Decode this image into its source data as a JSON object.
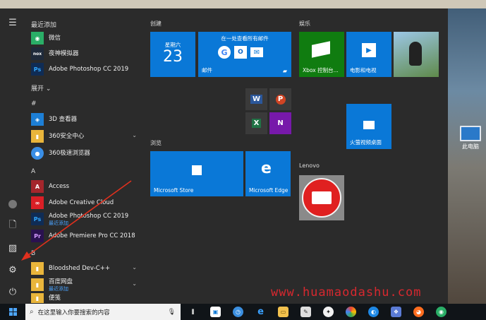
{
  "desktop": {
    "icon_label": "此电脑"
  },
  "sidebar": {
    "recent_header": "最近添加",
    "expand_label": "展开",
    "recent": [
      {
        "name": "微信",
        "color": "#2aae67",
        "glyph": "◉"
      },
      {
        "name": "夜神模拟器",
        "color": "#1f2a3a",
        "glyph": "nox"
      },
      {
        "name": "Adobe Photoshop CC 2019",
        "color": "#0f2c55",
        "glyph": "Ps"
      }
    ],
    "sections": [
      {
        "letter": "#",
        "items": [
          {
            "name": "3D 查看器",
            "color": "#1d7fd6",
            "glyph": "◈"
          },
          {
            "name": "360安全中心",
            "color": "#e9b53b",
            "glyph": "▮",
            "chevron": true
          },
          {
            "name": "360极速浏览器",
            "color": "#3a8ee6",
            "glyph": "●"
          }
        ]
      },
      {
        "letter": "A",
        "items": [
          {
            "name": "Access",
            "color": "#a4262c",
            "glyph": "A"
          },
          {
            "name": "Adobe Creative Cloud",
            "color": "#da1f26",
            "glyph": "∞"
          },
          {
            "name": "Adobe Photoshop CC 2019",
            "sub": "最近添加",
            "color": "#0f2c55",
            "glyph": "Ps"
          },
          {
            "name": "Adobe Premiere Pro CC 2018",
            "color": "#2a1150",
            "glyph": "Pr"
          }
        ]
      },
      {
        "letter": "B",
        "items": [
          {
            "name": "Bloodshed Dev-C++",
            "color": "#e9b53b",
            "glyph": "▮",
            "chevron": true
          },
          {
            "name": "百度网盘",
            "sub": "最近添加",
            "color": "#e9b53b",
            "glyph": "▮",
            "chevron": true
          },
          {
            "name": "便笺",
            "color": "#e9b53b",
            "glyph": "▮"
          }
        ]
      }
    ]
  },
  "groups": {
    "create": "创建",
    "entertainment": "娱乐",
    "browse": "浏览",
    "lenovo": "Lenovo"
  },
  "tiles": {
    "calendar_day": "星期六",
    "calendar_date": "23",
    "mail_header": "在一处查看所有邮件",
    "mail_label": "邮件",
    "xbox_label": "Xbox 控制台...",
    "movies_label": "电影和电视",
    "video_label": "火萤视频桌面",
    "store_label": "Microsoft Store",
    "edge_label": "Microsoft Edge",
    "word_glyph": "W",
    "ppt_glyph": "P",
    "excel_glyph": "X",
    "onenote_glyph": "N"
  },
  "taskbar": {
    "search_placeholder": "在这里输入你要搜索的内容"
  },
  "watermark": "www.huamaodashu.com",
  "colors": {
    "tile_blue": "#0a78d7",
    "xbox_green": "#107c10",
    "lenovo_red": "#e02020",
    "accent_link": "#4aa3ff"
  }
}
